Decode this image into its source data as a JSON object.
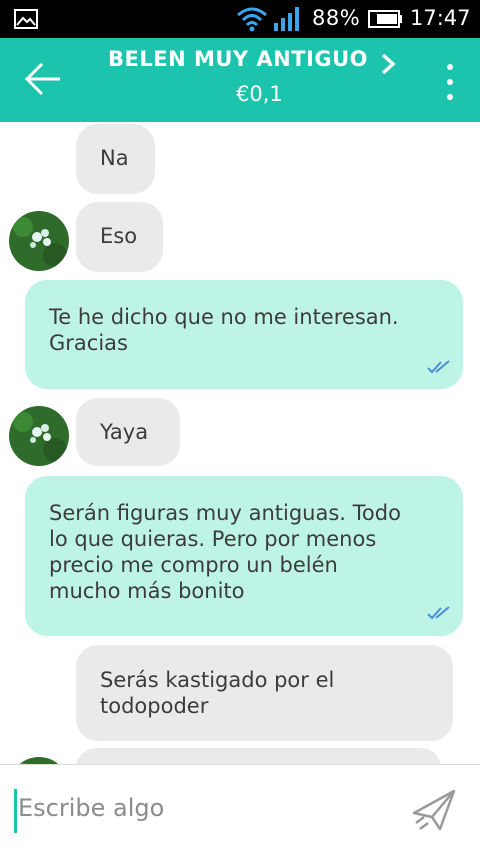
{
  "statusbar": {
    "battery_pct": "88%",
    "time": "17:47",
    "icons": [
      "image-icon",
      "wifi-icon",
      "signal-icon",
      "battery-icon"
    ]
  },
  "header": {
    "title": "BELEN MUY ANTIGUO",
    "price": "€0,1",
    "icons": [
      "back-arrow-icon",
      "chevron-right-icon",
      "more-vert-icon"
    ]
  },
  "messages": [
    {
      "side": "in",
      "text": "Na",
      "avatar": false
    },
    {
      "side": "in",
      "text": "Eso",
      "avatar": true
    },
    {
      "side": "out",
      "text": "Te he dicho que no me interesan.\nGracias",
      "status": "read"
    },
    {
      "side": "in",
      "text": "Yaya",
      "avatar": true
    },
    {
      "side": "out",
      "text": "Serán figuras muy antiguas. Todo\nlo que quieras. Pero por menos\nprecio me compro un belén\nmucho más bonito",
      "status": "read"
    },
    {
      "side": "in",
      "text": "Serás kastigado por el\ntodopoder",
      "avatar": false
    }
  ],
  "composer": {
    "placeholder": "Escribe algo",
    "send_icon": "send-icon"
  },
  "colors": {
    "accent": "#1cc3ad",
    "outgoing_bubble": "#bdf4e6",
    "incoming_bubble": "#eaeaea",
    "read_check": "#4a8fd6"
  }
}
